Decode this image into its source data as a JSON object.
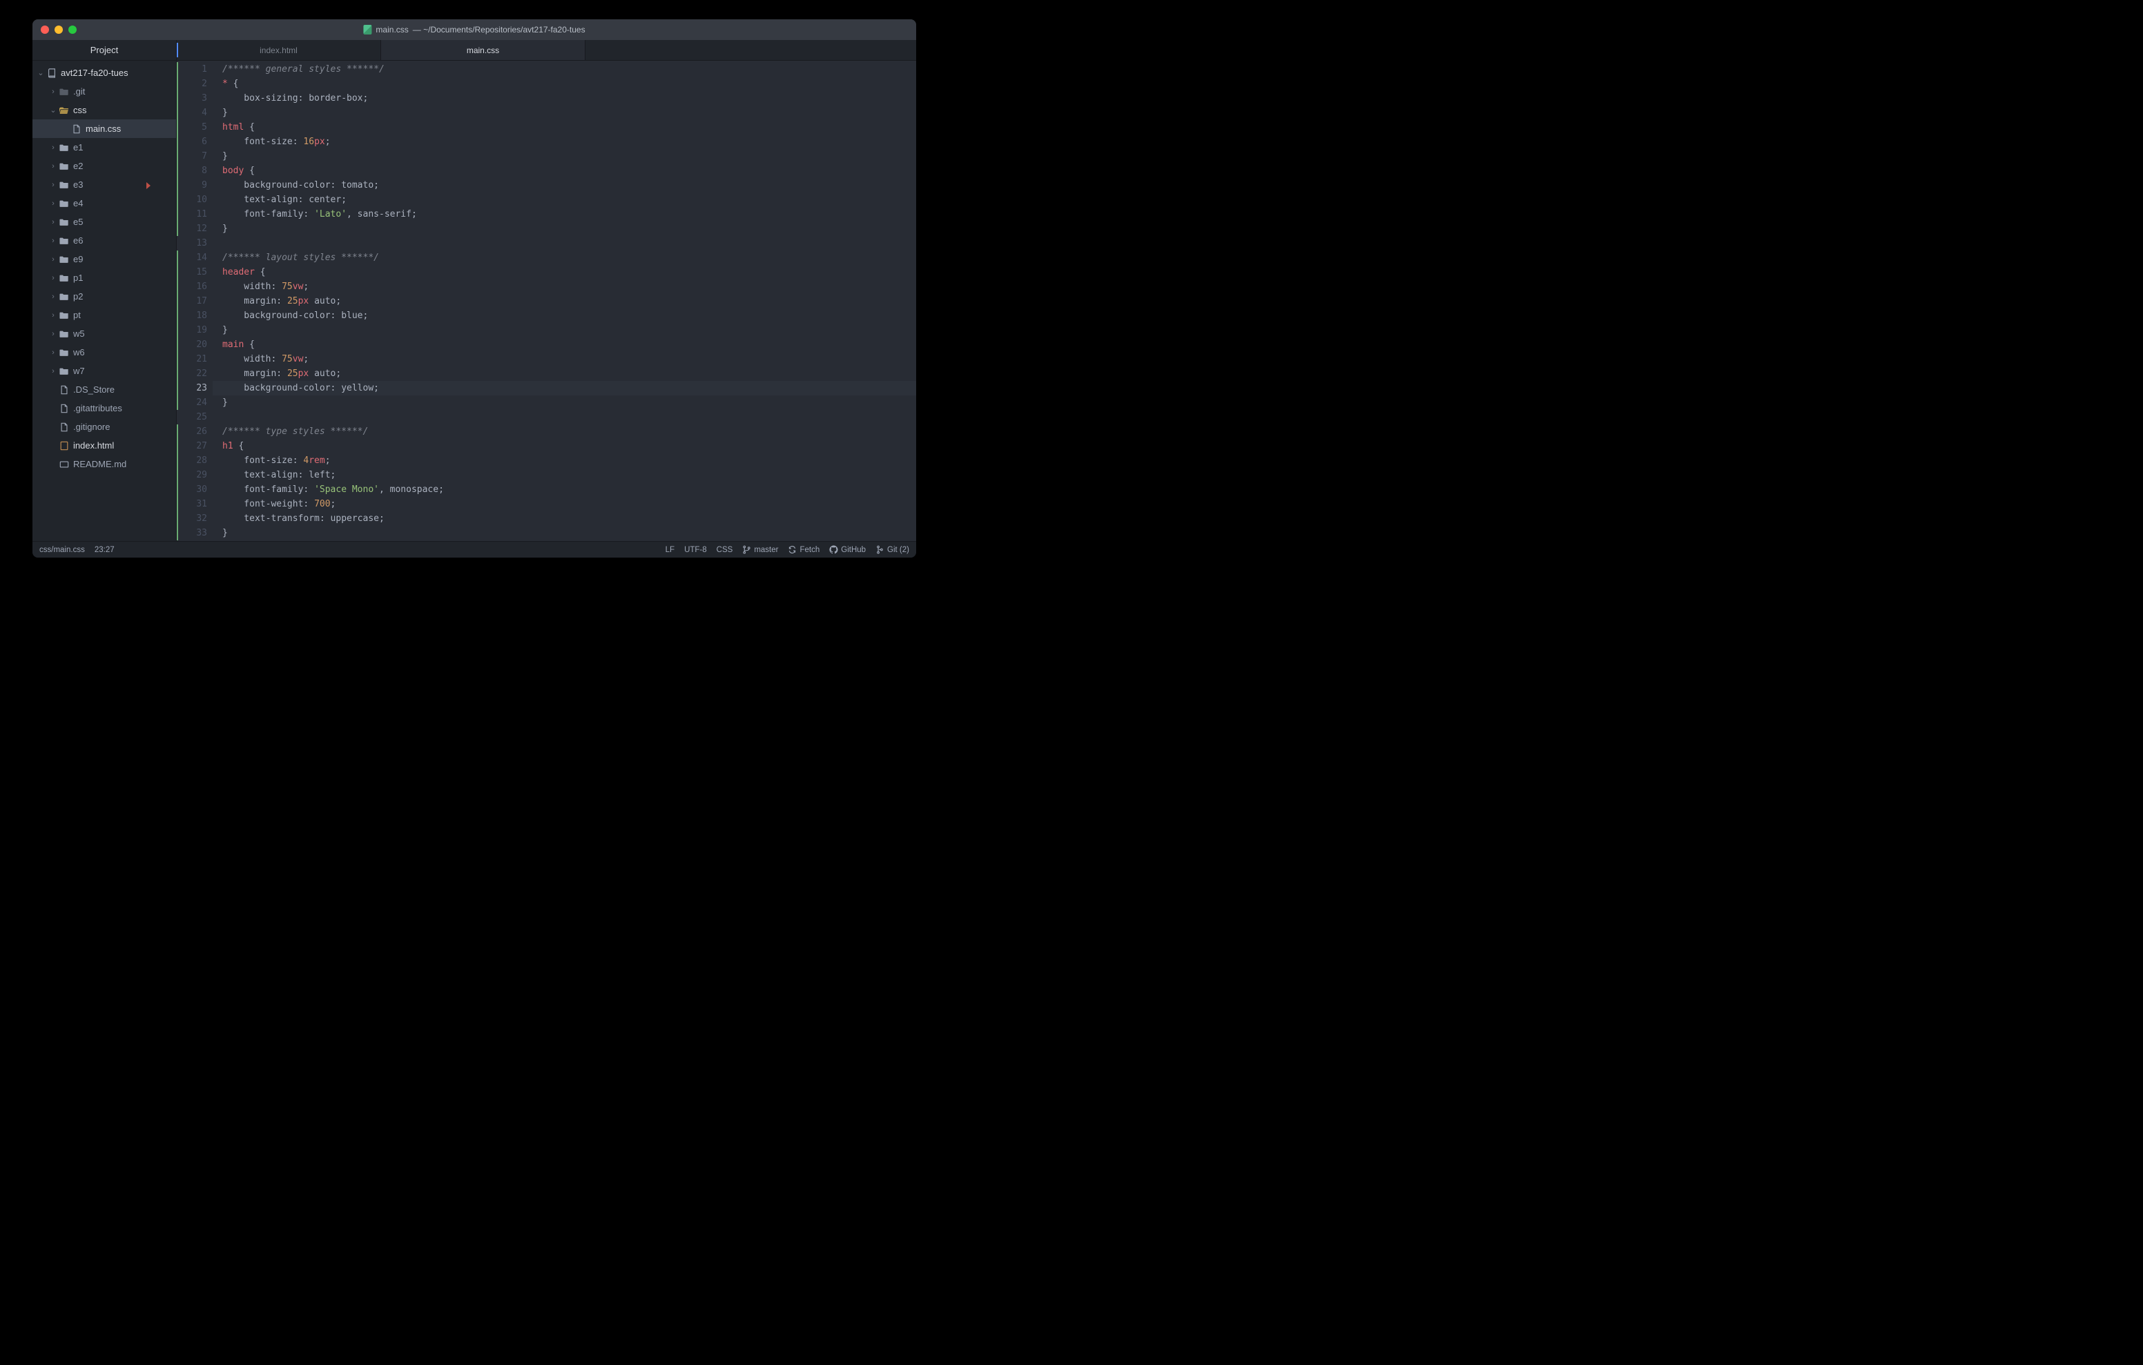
{
  "title": {
    "filename": "main.css",
    "path": "— ~/Documents/Repositories/avt217-fa20-tues"
  },
  "sidebar": {
    "header": "Project",
    "tree": [
      {
        "id": "root",
        "label": "avt217-fa20-tues",
        "icon": "repo",
        "indent": 0,
        "chev": "open",
        "cls": "root"
      },
      {
        "id": "git",
        "label": ".git",
        "icon": "fold-dim",
        "indent": 1,
        "chev": "closed"
      },
      {
        "id": "css",
        "label": "css",
        "icon": "fold-open",
        "indent": 1,
        "chev": "open",
        "cls": "hl"
      },
      {
        "id": "maincss",
        "label": "main.css",
        "icon": "file",
        "indent": 2,
        "sel": true
      },
      {
        "id": "e1",
        "label": "e1",
        "icon": "fold-closed",
        "indent": 1,
        "chev": "closed"
      },
      {
        "id": "e2",
        "label": "e2",
        "icon": "fold-closed",
        "indent": 1,
        "chev": "closed"
      },
      {
        "id": "e3",
        "label": "e3",
        "icon": "fold-closed",
        "indent": 1,
        "chev": "closed"
      },
      {
        "id": "e4",
        "label": "e4",
        "icon": "fold-closed",
        "indent": 1,
        "chev": "closed"
      },
      {
        "id": "e5",
        "label": "e5",
        "icon": "fold-closed",
        "indent": 1,
        "chev": "closed"
      },
      {
        "id": "e6",
        "label": "e6",
        "icon": "fold-closed",
        "indent": 1,
        "chev": "closed"
      },
      {
        "id": "e9",
        "label": "e9",
        "icon": "fold-closed",
        "indent": 1,
        "chev": "closed"
      },
      {
        "id": "p1",
        "label": "p1",
        "icon": "fold-closed",
        "indent": 1,
        "chev": "closed"
      },
      {
        "id": "p2",
        "label": "p2",
        "icon": "fold-closed",
        "indent": 1,
        "chev": "closed"
      },
      {
        "id": "pt",
        "label": "pt",
        "icon": "fold-closed",
        "indent": 1,
        "chev": "closed"
      },
      {
        "id": "w5",
        "label": "w5",
        "icon": "fold-closed",
        "indent": 1,
        "chev": "closed"
      },
      {
        "id": "w6",
        "label": "w6",
        "icon": "fold-closed",
        "indent": 1,
        "chev": "closed"
      },
      {
        "id": "w7",
        "label": "w7",
        "icon": "fold-closed",
        "indent": 1,
        "chev": "closed"
      },
      {
        "id": "dsstore",
        "label": ".DS_Store",
        "icon": "file",
        "indent": 1
      },
      {
        "id": "gitattr",
        "label": ".gitattributes",
        "icon": "file",
        "indent": 1
      },
      {
        "id": "gitign",
        "label": ".gitignore",
        "icon": "file",
        "indent": 1
      },
      {
        "id": "indexhtml",
        "label": "index.html",
        "icon": "html",
        "indent": 1,
        "cls": "hl"
      },
      {
        "id": "readme",
        "label": "README.md",
        "icon": "md",
        "indent": 1
      }
    ]
  },
  "tabs": [
    {
      "label": "index.html",
      "active": false,
      "modified": true
    },
    {
      "label": "main.css",
      "active": true,
      "modified": false
    }
  ],
  "editor": {
    "cursor_line": 23,
    "gutter_bars": [
      {
        "from": 1,
        "to": 12
      },
      {
        "from": 14,
        "to": 24
      },
      {
        "from": 26,
        "to": 33
      }
    ],
    "marker_line": 9,
    "lines": [
      {
        "n": 1,
        "t": [
          [
            "/****** general styles ******/",
            "comment"
          ]
        ]
      },
      {
        "n": 2,
        "t": [
          [
            "* ",
            "sel"
          ],
          [
            "{",
            "punc"
          ]
        ]
      },
      {
        "n": 3,
        "t": [
          [
            "    box-sizing",
            "prop"
          ],
          [
            ": ",
            "punc"
          ],
          [
            "border-box",
            "val"
          ],
          [
            ";",
            "punc"
          ]
        ]
      },
      {
        "n": 4,
        "t": [
          [
            "}",
            "punc"
          ]
        ]
      },
      {
        "n": 5,
        "t": [
          [
            "html ",
            "sel"
          ],
          [
            "{",
            "punc"
          ]
        ]
      },
      {
        "n": 6,
        "t": [
          [
            "    font-size",
            "prop"
          ],
          [
            ": ",
            "punc"
          ],
          [
            "16",
            "num"
          ],
          [
            "px",
            "unit"
          ],
          [
            ";",
            "punc"
          ]
        ]
      },
      {
        "n": 7,
        "t": [
          [
            "}",
            "punc"
          ]
        ]
      },
      {
        "n": 8,
        "t": [
          [
            "body ",
            "sel"
          ],
          [
            "{",
            "punc"
          ]
        ]
      },
      {
        "n": 9,
        "t": [
          [
            "    background-color",
            "prop"
          ],
          [
            ": ",
            "punc"
          ],
          [
            "tomato",
            "val"
          ],
          [
            ";",
            "punc"
          ]
        ]
      },
      {
        "n": 10,
        "t": [
          [
            "    text-align",
            "prop"
          ],
          [
            ": ",
            "punc"
          ],
          [
            "center",
            "val"
          ],
          [
            ";",
            "punc"
          ]
        ]
      },
      {
        "n": 11,
        "t": [
          [
            "    font-family",
            "prop"
          ],
          [
            ": ",
            "punc"
          ],
          [
            "'Lato'",
            "str"
          ],
          [
            ", sans-serif",
            "val"
          ],
          [
            ";",
            "punc"
          ]
        ]
      },
      {
        "n": 12,
        "t": [
          [
            "}",
            "punc"
          ]
        ]
      },
      {
        "n": 13,
        "t": []
      },
      {
        "n": 14,
        "t": [
          [
            "/****** layout styles ******/",
            "comment"
          ]
        ]
      },
      {
        "n": 15,
        "t": [
          [
            "header ",
            "sel"
          ],
          [
            "{",
            "punc"
          ]
        ]
      },
      {
        "n": 16,
        "t": [
          [
            "    width",
            "prop"
          ],
          [
            ": ",
            "punc"
          ],
          [
            "75",
            "num"
          ],
          [
            "vw",
            "unit"
          ],
          [
            ";",
            "punc"
          ]
        ]
      },
      {
        "n": 17,
        "t": [
          [
            "    margin",
            "prop"
          ],
          [
            ": ",
            "punc"
          ],
          [
            "25",
            "num"
          ],
          [
            "px",
            "unit"
          ],
          [
            " auto",
            "val"
          ],
          [
            ";",
            "punc"
          ]
        ]
      },
      {
        "n": 18,
        "t": [
          [
            "    background-color",
            "prop"
          ],
          [
            ": ",
            "punc"
          ],
          [
            "blue",
            "val"
          ],
          [
            ";",
            "punc"
          ]
        ]
      },
      {
        "n": 19,
        "t": [
          [
            "}",
            "punc"
          ]
        ]
      },
      {
        "n": 20,
        "t": [
          [
            "main ",
            "sel"
          ],
          [
            "{",
            "punc"
          ]
        ]
      },
      {
        "n": 21,
        "t": [
          [
            "    width",
            "prop"
          ],
          [
            ": ",
            "punc"
          ],
          [
            "75",
            "num"
          ],
          [
            "vw",
            "unit"
          ],
          [
            ";",
            "punc"
          ]
        ]
      },
      {
        "n": 22,
        "t": [
          [
            "    margin",
            "prop"
          ],
          [
            ": ",
            "punc"
          ],
          [
            "25",
            "num"
          ],
          [
            "px",
            "unit"
          ],
          [
            " auto",
            "val"
          ],
          [
            ";",
            "punc"
          ]
        ]
      },
      {
        "n": 23,
        "t": [
          [
            "    background-color",
            "prop"
          ],
          [
            ": ",
            "punc"
          ],
          [
            "yellow",
            "val"
          ],
          [
            ";",
            "punc"
          ]
        ]
      },
      {
        "n": 24,
        "t": [
          [
            "}",
            "punc"
          ]
        ]
      },
      {
        "n": 25,
        "t": []
      },
      {
        "n": 26,
        "t": [
          [
            "/****** type styles ******/",
            "comment"
          ]
        ]
      },
      {
        "n": 27,
        "t": [
          [
            "h1 ",
            "sel"
          ],
          [
            "{",
            "punc"
          ]
        ]
      },
      {
        "n": 28,
        "t": [
          [
            "    font-size",
            "prop"
          ],
          [
            ": ",
            "punc"
          ],
          [
            "4",
            "num"
          ],
          [
            "rem",
            "unit"
          ],
          [
            ";",
            "punc"
          ]
        ]
      },
      {
        "n": 29,
        "t": [
          [
            "    text-align",
            "prop"
          ],
          [
            ": ",
            "punc"
          ],
          [
            "left",
            "val"
          ],
          [
            ";",
            "punc"
          ]
        ]
      },
      {
        "n": 30,
        "t": [
          [
            "    font-family",
            "prop"
          ],
          [
            ": ",
            "punc"
          ],
          [
            "'Space Mono'",
            "str"
          ],
          [
            ", monospace",
            "val"
          ],
          [
            ";",
            "punc"
          ]
        ]
      },
      {
        "n": 31,
        "t": [
          [
            "    font-weight",
            "prop"
          ],
          [
            ": ",
            "punc"
          ],
          [
            "700",
            "num"
          ],
          [
            ";",
            "punc"
          ]
        ]
      },
      {
        "n": 32,
        "t": [
          [
            "    text-transform",
            "prop"
          ],
          [
            ": ",
            "punc"
          ],
          [
            "uppercase",
            "val"
          ],
          [
            ";",
            "punc"
          ]
        ]
      },
      {
        "n": 33,
        "t": [
          [
            "}",
            "punc"
          ]
        ]
      }
    ]
  },
  "statusbar": {
    "path": "css/main.css",
    "cursor": "23:27",
    "eol": "LF",
    "encoding": "UTF-8",
    "lang": "CSS",
    "branch": "master",
    "fetch": "Fetch",
    "github": "GitHub",
    "git": "Git (2)"
  }
}
